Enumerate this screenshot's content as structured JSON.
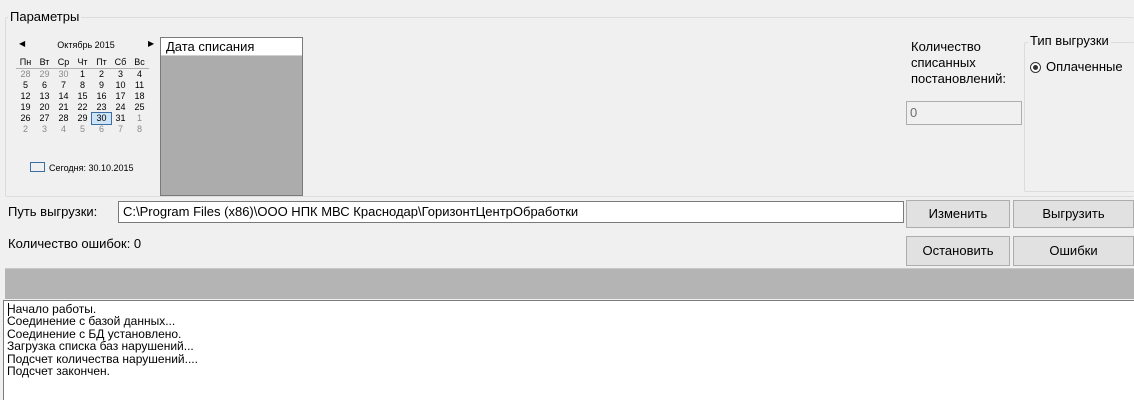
{
  "params_group": {
    "title": "Параметры"
  },
  "calendar": {
    "month_title": "Октябрь 2015",
    "prev_icon": "triangle-left",
    "next_icon": "triangle-right",
    "weekdays": [
      "Пн",
      "Вт",
      "Ср",
      "Чт",
      "Пт",
      "Сб",
      "Вс"
    ],
    "weeks": [
      [
        "28",
        "29",
        "30",
        "1",
        "2",
        "3",
        "4"
      ],
      [
        "5",
        "6",
        "7",
        "8",
        "9",
        "10",
        "11"
      ],
      [
        "12",
        "13",
        "14",
        "15",
        "16",
        "17",
        "18"
      ],
      [
        "19",
        "20",
        "21",
        "22",
        "23",
        "24",
        "25"
      ],
      [
        "26",
        "27",
        "28",
        "29",
        "30",
        "31",
        "1"
      ],
      [
        "2",
        "3",
        "4",
        "5",
        "6",
        "7",
        "8"
      ]
    ],
    "selected_day": "30",
    "today_label": "Сегодня: 30.10.2015"
  },
  "dates_list": {
    "header": "Дата списания"
  },
  "count_panel": {
    "label": "Количество списанных постановлений:",
    "value": "0"
  },
  "export_type": {
    "title": "Тип выгрузки",
    "option_paid": "Оплаченные"
  },
  "path": {
    "label": "Путь выгрузки:",
    "value": "C:\\Program Files (x86)\\ООО НПК МВС Краснодар\\ГоризонтЦентрОбработки"
  },
  "buttons": {
    "change": "Изменить",
    "export": "Выгрузить",
    "stop": "Остановить",
    "errors": "Ошибки"
  },
  "errors_count": {
    "label": "Количество ошибок: 0"
  },
  "log": {
    "lines": [
      "Начало работы.",
      "Соединение с базой данных...",
      "Соединение с БД установлено.",
      "Загрузка списка баз нарушений...",
      "Подсчет количества нарушений....",
      "Подсчет закончен."
    ]
  }
}
